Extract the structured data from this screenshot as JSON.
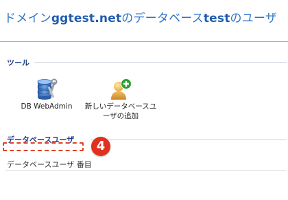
{
  "title": {
    "prefix": "ドメイン",
    "domain": "ggtest.net",
    "middle": "のデータベース",
    "db": "test",
    "suffix": "のユーザ"
  },
  "tools_section": {
    "header": "ツール",
    "items": [
      {
        "label": "DB WebAdmin",
        "icon": "database-tools-icon"
      },
      {
        "label_line1": "新しいデータベースユ",
        "label_line2": "ーザの追加",
        "icon": "add-user-icon"
      }
    ]
  },
  "users_section": {
    "header": "データベースユーザ",
    "callout_number": "4",
    "column_label": "データベースユーザ 番目"
  },
  "colors": {
    "title_blue": "#2f73c9",
    "header_navy": "#1d3f86",
    "callout_red": "#e0301f"
  }
}
